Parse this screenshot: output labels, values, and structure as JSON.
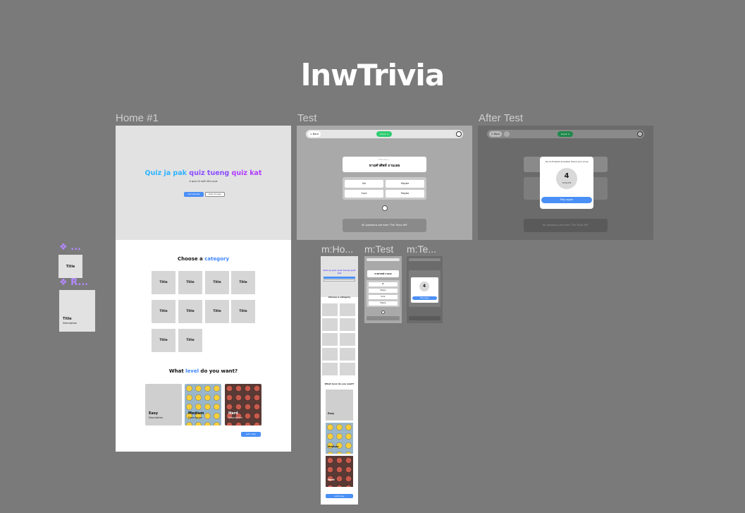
{
  "app_title": "lnwTrivia",
  "frames": {
    "home": "Home #1",
    "test": "Test",
    "after": "After Test",
    "m_home": "m:Ho...",
    "m_test": "m:Test",
    "m_after": "m:Te..."
  },
  "components": {
    "comp1_label": "❖ ...",
    "comp1_title": "Title",
    "comp2_label": "❖ R...",
    "comp2_title": "Title",
    "comp2_desc": "Description"
  },
  "home": {
    "hero_part1": "Quiz ja pak ",
    "hero_part2": "quiz tueng ",
    "hero_part3": "quiz kat",
    "hero_sub": "A quiz IQ with this quiz",
    "btn_start": "Get started",
    "btn_how": "How to play",
    "cat_prefix": "Choose a ",
    "cat_highlight": "category",
    "tiles": [
      "Title",
      "Title",
      "Title",
      "Title",
      "Title",
      "Title",
      "Title",
      "Title",
      "Title",
      "Title"
    ],
    "level_prefix": "What ",
    "level_highlight": "level",
    "level_suffix": " do you want?",
    "levels": [
      {
        "name": "Easy",
        "desc": "Description"
      },
      {
        "name": "Medium",
        "desc": "Description"
      },
      {
        "name": "Hard",
        "desc": "Description"
      }
    ],
    "lets_play": "Let's play"
  },
  "test": {
    "back": "< Back",
    "score": "Score: 0",
    "question_small": "How many ...",
    "question": "ทายคำศัพท์ ถามเลย",
    "options": [
      "No",
      "Maybe",
      "Sure",
      "Maybe"
    ],
    "credit": "All questions are from 'The Trivia API'"
  },
  "after": {
    "back": "< Back",
    "score": "Score: 4",
    "modal_title": "You've finished all quizes. Here's your score",
    "score_value": "4",
    "score_label": "Correct ID",
    "play_again": "Play again",
    "credit": "All questions are from 'The Trivia API'"
  },
  "mobile": {
    "hero": "Quiz ja pak quiz tueng quiz kat",
    "cat_title": "Choose a category",
    "level_title": "What level do you want?",
    "levels": [
      "Easy",
      "Medium",
      "Hard"
    ],
    "lets_play": "Let's play",
    "test_question": "ทายคำศัพท์ ถามเลย",
    "test_options": [
      "No",
      "Maybe",
      "Sure",
      "Maybe"
    ],
    "after_score": "4",
    "after_btn": "Play again"
  }
}
